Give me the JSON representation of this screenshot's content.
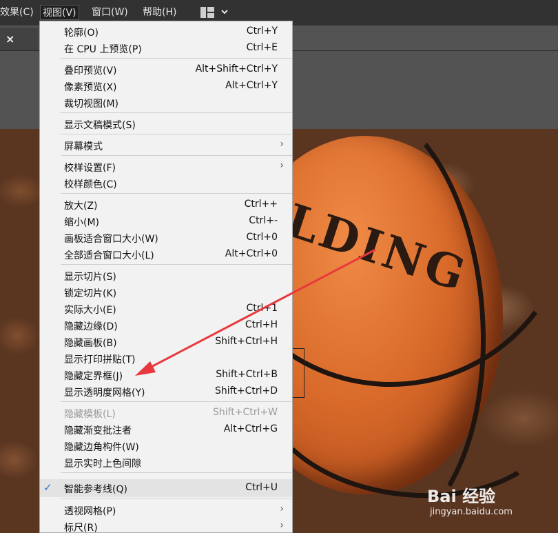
{
  "menubar": {
    "items": [
      "效果(C)",
      "视图(V)",
      "窗口(W)",
      "帮助(H)"
    ]
  },
  "tab": {
    "close_glyph": "×"
  },
  "menu": {
    "items": [
      {
        "label": "轮廓(O)",
        "shortcut": "Ctrl+Y"
      },
      {
        "label": "在 CPU 上预览(P)",
        "shortcut": "Ctrl+E"
      },
      {
        "label": "叠印预览(V)",
        "shortcut": "Alt+Shift+Ctrl+Y"
      },
      {
        "label": "像素预览(X)",
        "shortcut": "Alt+Ctrl+Y"
      },
      {
        "label": "裁切视图(M)",
        "shortcut": ""
      },
      {
        "label": "显示文稿模式(S)",
        "shortcut": ""
      },
      {
        "label": "屏幕模式",
        "shortcut": "",
        "submenu": true
      },
      {
        "label": "校样设置(F)",
        "shortcut": "",
        "submenu": true
      },
      {
        "label": "校样颜色(C)",
        "shortcut": ""
      },
      {
        "label": "放大(Z)",
        "shortcut": "Ctrl++"
      },
      {
        "label": "缩小(M)",
        "shortcut": "Ctrl+-"
      },
      {
        "label": "画板适合窗口大小(W)",
        "shortcut": "Ctrl+0"
      },
      {
        "label": "全部适合窗口大小(L)",
        "shortcut": "Alt+Ctrl+0"
      },
      {
        "label": "显示切片(S)",
        "shortcut": ""
      },
      {
        "label": "锁定切片(K)",
        "shortcut": ""
      },
      {
        "label": "实际大小(E)",
        "shortcut": "Ctrl+1"
      },
      {
        "label": "隐藏边缘(D)",
        "shortcut": "Ctrl+H"
      },
      {
        "label": "隐藏画板(B)",
        "shortcut": "Shift+Ctrl+H"
      },
      {
        "label": "显示打印拼贴(T)",
        "shortcut": ""
      },
      {
        "label": "隐藏定界框(J)",
        "shortcut": "Shift+Ctrl+B"
      },
      {
        "label": "显示透明度网格(Y)",
        "shortcut": "Shift+Ctrl+D"
      },
      {
        "label": "隐藏模板(L)",
        "shortcut": "Shift+Ctrl+W",
        "disabled": true
      },
      {
        "label": "隐藏渐变批注者",
        "shortcut": "Alt+Ctrl+G"
      },
      {
        "label": "隐藏边角构件(W)",
        "shortcut": ""
      },
      {
        "label": "显示实时上色间隙",
        "shortcut": ""
      },
      {
        "label": "智能参考线(Q)",
        "shortcut": "Ctrl+U",
        "checked": true
      },
      {
        "label": "透视网格(P)",
        "shortcut": "",
        "submenu": true
      },
      {
        "label": "标尺(R)",
        "shortcut": "",
        "submenu": true
      }
    ]
  },
  "icons": {
    "check": "✓",
    "submenu": "›",
    "workspace": "workspace-switcher-icon"
  },
  "photo": {
    "ball_text": "LDING"
  },
  "watermark": {
    "brand": "Bai  经验",
    "url": "jingyan.baidu.com"
  },
  "colors": {
    "arrow": "#e8383d",
    "check": "#2f6fd6"
  }
}
